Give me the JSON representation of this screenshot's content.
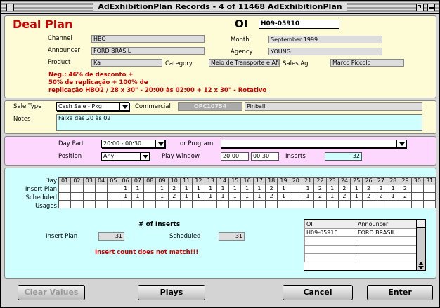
{
  "window": {
    "title": "AdExhibitionPlan Records - 4 of 11468 AdExhibitionPlan"
  },
  "header": {
    "title": "Deal Plan",
    "oi_label": "OI",
    "oi_value": "H09-05910"
  },
  "deal": {
    "channel_label": "Channel",
    "channel": "HBO",
    "month_label": "Month",
    "month": "September 1999",
    "announcer_label": "Announcer",
    "announcer": "FORD BRASIL",
    "agency_label": "Agency",
    "agency": "YOUNG",
    "product_label": "Product",
    "product": "Ka",
    "category_label": "Category",
    "category": "Meio de Transporte e Afi",
    "sales_ag_label": "Sales Ag",
    "sales_ag": "Marco Piccolo",
    "negotiation": [
      "Neg.: 46% de desconto +",
      "50% de replicação + 100% de",
      "replicação HBO2 / 28 x 30\" - 20:00 às 02:00 + 12 x 30\" - Rotativo"
    ]
  },
  "sale": {
    "sale_type_label": "Sale Type",
    "sale_type": "Cash Sale - Pkg",
    "commercial_label": "Commercial",
    "commercial_code": "OPC10754",
    "commercial_name": "Pinball",
    "notes_label": "Notes",
    "notes": "Faixa das 20 às 02"
  },
  "daypart": {
    "day_part_label": "Day Part",
    "day_part": "20:00 - 00:30",
    "or_program_label": "or Program",
    "program": "",
    "position_label": "Position",
    "position": "Any",
    "play_window_label": "Play Window",
    "play_start": "20:00",
    "play_end": "00:30",
    "inserts_label": "Inserts",
    "inserts": "32"
  },
  "schedule": {
    "row_labels": [
      "Day",
      "Insert Plan",
      "Scheduled",
      "Usages"
    ],
    "days": [
      "01",
      "02",
      "03",
      "04",
      "05",
      "06",
      "07",
      "08",
      "09",
      "10",
      "11",
      "12",
      "13",
      "14",
      "15",
      "16",
      "17",
      "18",
      "19",
      "20",
      "21",
      "22",
      "23",
      "24",
      "25",
      "26",
      "27",
      "28",
      "29",
      "30",
      "31"
    ],
    "insert_plan": [
      "",
      "",
      "",
      "",
      "",
      "1",
      "1",
      "",
      "1",
      "2",
      "1",
      "1",
      "1",
      "1",
      "1",
      "1",
      "1",
      "2",
      "1",
      "",
      "1",
      "2",
      "1",
      "2",
      "1",
      "2",
      "2",
      "1",
      "2",
      "",
      ""
    ],
    "scheduled": [
      "",
      "",
      "",
      "",
      "",
      "1",
      "1",
      "",
      "1",
      "2",
      "1",
      "1",
      "1",
      "1",
      "1",
      "1",
      "1",
      "2",
      "1",
      "",
      "1",
      "2",
      "1",
      "2",
      "1",
      "2",
      "2",
      "1",
      "2",
      "",
      ""
    ],
    "usages": [
      "",
      "",
      "",
      "",
      "",
      "",
      "",
      "",
      "",
      "",
      "",
      "",
      "",
      "",
      "",
      "",
      "",
      "",
      "",
      "",
      "",
      "",
      "",
      "",
      "",
      "",
      "",
      "",
      "",
      "",
      ""
    ]
  },
  "inserts_summary": {
    "title": "# of Inserts",
    "insert_plan_label": "Insert Plan",
    "insert_plan": "31",
    "scheduled_label": "Scheduled",
    "scheduled": "31",
    "warning": "Insert count does not match!!!"
  },
  "oi_list": {
    "headers": [
      "OI",
      "Announcer"
    ],
    "rows": [
      [
        "H09-05910",
        "FORD BRASIL"
      ]
    ]
  },
  "buttons": {
    "clear": "Clear Values",
    "plays": "Plays",
    "cancel": "Cancel",
    "enter": "Enter"
  }
}
